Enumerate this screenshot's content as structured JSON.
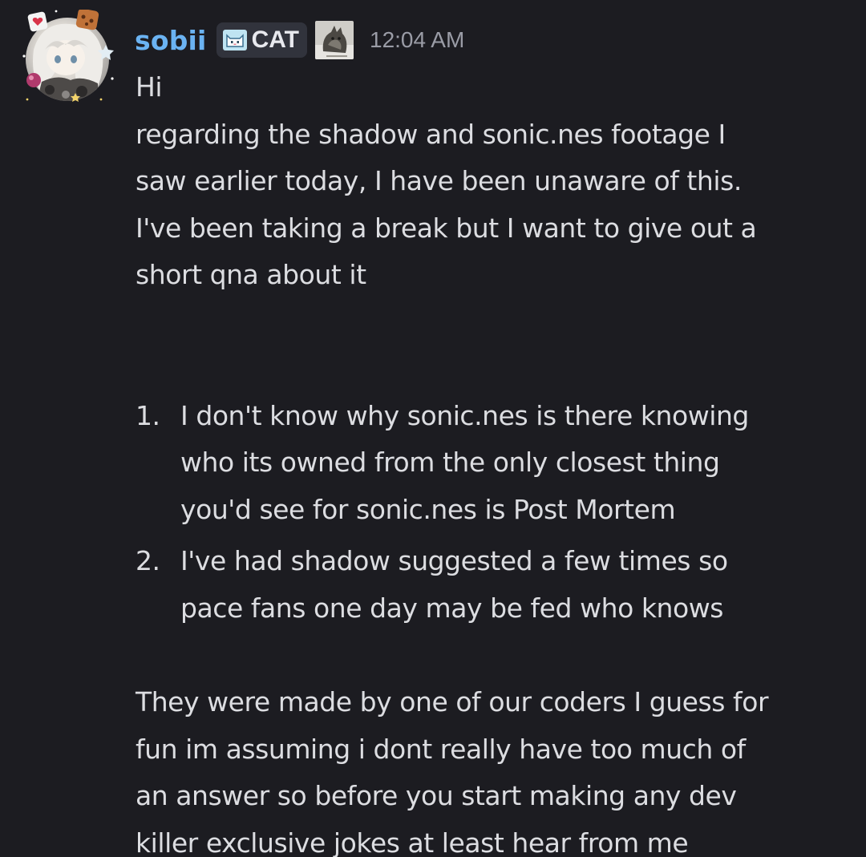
{
  "message": {
    "author": {
      "username": "sobii",
      "tag_label": "CAT",
      "tag_icon": "cat-icon",
      "role_icon": "cat-photo-role-icon",
      "name_color": "#6bb3f2"
    },
    "timestamp": "12:04 AM",
    "greeting": "Hi",
    "intro_lines": [
      "regarding the shadow and sonic.nes footage I",
      "saw earlier today, I have been unaware of this.",
      "I've been taking a break but I want to give out a",
      "short qna about it"
    ],
    "list": [
      {
        "number": "1.",
        "lines": [
          "I don't know why sonic.nes is there knowing",
          "who its owned from the only closest thing",
          "you'd see for sonic.nes is Post Mortem"
        ]
      },
      {
        "number": "2.",
        "lines": [
          "I've had shadow suggested a few times so",
          "pace fans one day may be fed who knows"
        ]
      }
    ],
    "closing_lines": [
      "They were made by one of our coders I guess for",
      "fun im assuming i dont really have too much of",
      "an answer so before you start making any dev",
      "killer exclusive jokes at least hear from me"
    ]
  },
  "colors": {
    "background": "#1c1c21",
    "text": "#dcdde1",
    "timestamp": "#9a9ca6",
    "tag_background": "#31333c"
  }
}
